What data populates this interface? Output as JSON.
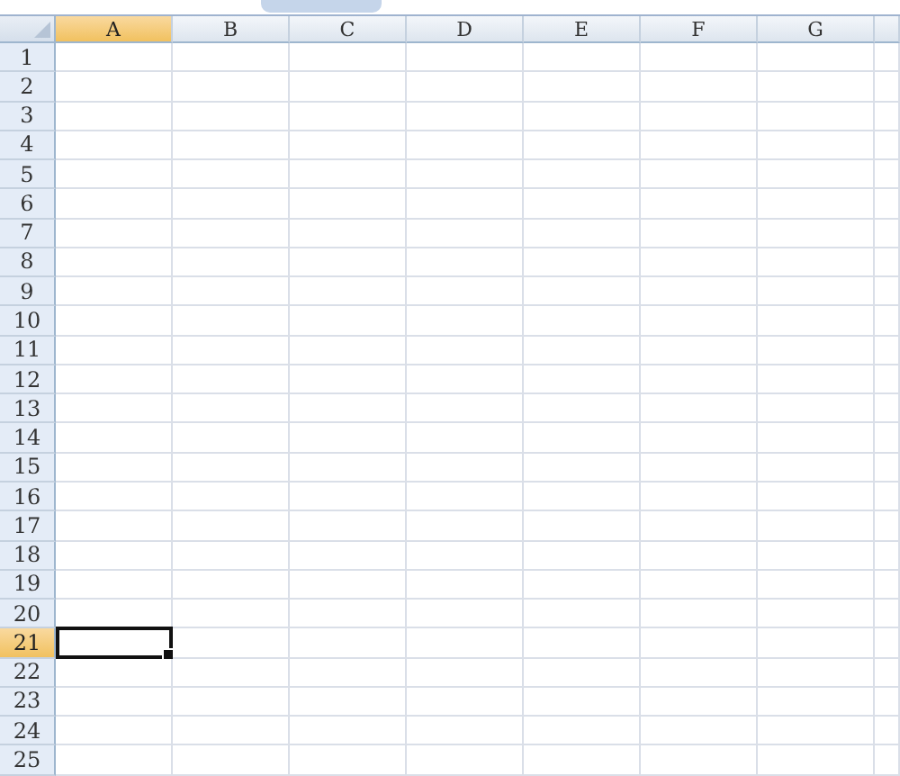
{
  "columns": [
    {
      "label": "A",
      "selected": true
    },
    {
      "label": "B",
      "selected": false
    },
    {
      "label": "C",
      "selected": false
    },
    {
      "label": "D",
      "selected": false
    },
    {
      "label": "E",
      "selected": false
    },
    {
      "label": "F",
      "selected": false
    },
    {
      "label": "G",
      "selected": false
    }
  ],
  "rows": [
    {
      "label": "1",
      "selected": false
    },
    {
      "label": "2",
      "selected": false
    },
    {
      "label": "3",
      "selected": false
    },
    {
      "label": "4",
      "selected": false
    },
    {
      "label": "5",
      "selected": false
    },
    {
      "label": "6",
      "selected": false
    },
    {
      "label": "7",
      "selected": false
    },
    {
      "label": "8",
      "selected": false
    },
    {
      "label": "9",
      "selected": false
    },
    {
      "label": "10",
      "selected": false
    },
    {
      "label": "11",
      "selected": false
    },
    {
      "label": "12",
      "selected": false
    },
    {
      "label": "13",
      "selected": false
    },
    {
      "label": "14",
      "selected": false
    },
    {
      "label": "15",
      "selected": false
    },
    {
      "label": "16",
      "selected": false
    },
    {
      "label": "17",
      "selected": false
    },
    {
      "label": "18",
      "selected": false
    },
    {
      "label": "19",
      "selected": false
    },
    {
      "label": "20",
      "selected": false
    },
    {
      "label": "21",
      "selected": true
    },
    {
      "label": "22",
      "selected": false
    },
    {
      "label": "23",
      "selected": false
    },
    {
      "label": "24",
      "selected": false
    },
    {
      "label": "25",
      "selected": false
    }
  ]
}
